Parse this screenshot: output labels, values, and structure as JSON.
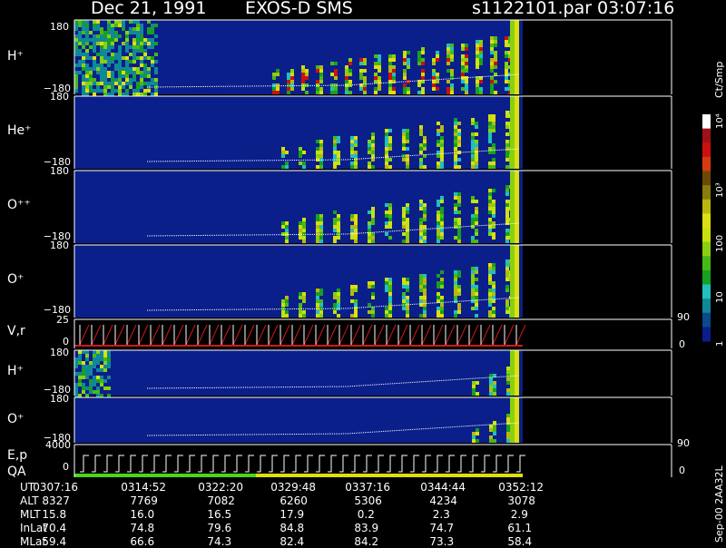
{
  "header": {
    "date": "Dec 21, 1991",
    "instrument": "EXOS-D SMS",
    "file": "s1122101.par",
    "time": "03:07:16"
  },
  "colorbar": {
    "unit_label": "Ct/Smp",
    "scale": "log",
    "range": [
      1,
      10000
    ],
    "tick_labels": [
      "10⁴",
      "10³",
      "100",
      "10",
      "1"
    ],
    "colors": [
      "#ffffff",
      "#a01018",
      "#cc1010",
      "#d83a10",
      "#6a4a08",
      "#8a7a10",
      "#b8b810",
      "#dede10",
      "#c8e010",
      "#88d010",
      "#48b818",
      "#18a020",
      "#20c0c0",
      "#108898",
      "#0a4a8a",
      "#0a1e8a"
    ]
  },
  "side_label": "Sep-00  2AA32L",
  "chart_data": {
    "type": "heatmap",
    "x_axis": {
      "label": "UT",
      "ticks": [
        "0307:16",
        "0314:52",
        "0322:20",
        "0329:48",
        "0337:16",
        "0344:44",
        "0352:12"
      ]
    },
    "panels": [
      {
        "species_html": "H<sup>+</sup>",
        "label": "H⁺",
        "yticks": [
          "180",
          "−180"
        ],
        "key": "h1"
      },
      {
        "label": "He⁺",
        "yticks": [
          "180",
          "−180"
        ],
        "key": "he"
      },
      {
        "label": "O⁺⁺",
        "yticks": [
          "180",
          "−180"
        ],
        "key": "opp"
      },
      {
        "label": "O⁺",
        "yticks": [
          "180",
          "−180"
        ],
        "key": "o1"
      },
      {
        "label": "V,r",
        "yticks": [
          "25",
          "0"
        ],
        "right_ticks": [
          "90",
          "0"
        ],
        "key": "vr"
      },
      {
        "label": "H⁺",
        "yticks": [
          "180",
          "−180"
        ],
        "key": "h2"
      },
      {
        "label": "O⁺",
        "yticks": [
          "180",
          "−180"
        ],
        "key": "o2"
      },
      {
        "label": "E,p",
        "label2": "QA",
        "yticks": [
          "4000",
          "0"
        ],
        "right_ticks": [
          "90",
          "0"
        ],
        "key": "ep"
      }
    ]
  },
  "table": {
    "rows": [
      {
        "name": "UT",
        "values": [
          "0307:16",
          "0314:52",
          "0322:20",
          "0329:48",
          "0337:16",
          "0344:44",
          "0352:12"
        ]
      },
      {
        "name": "ALT",
        "values": [
          "8327",
          "7769",
          "7082",
          "6260",
          "5306",
          "4234",
          "3078"
        ]
      },
      {
        "name": "MLT",
        "values": [
          "15.8",
          "16.0",
          "16.5",
          "17.9",
          "0.2",
          "2.3",
          "2.9"
        ]
      },
      {
        "name": "InLat",
        "values": [
          "70.4",
          "74.8",
          "79.6",
          "84.8",
          "83.9",
          "74.7",
          "61.1"
        ]
      },
      {
        "name": "MLat",
        "values": [
          "59.4",
          "66.6",
          "74.3",
          "82.4",
          "84.2",
          "73.3",
          "58.4"
        ]
      }
    ]
  }
}
